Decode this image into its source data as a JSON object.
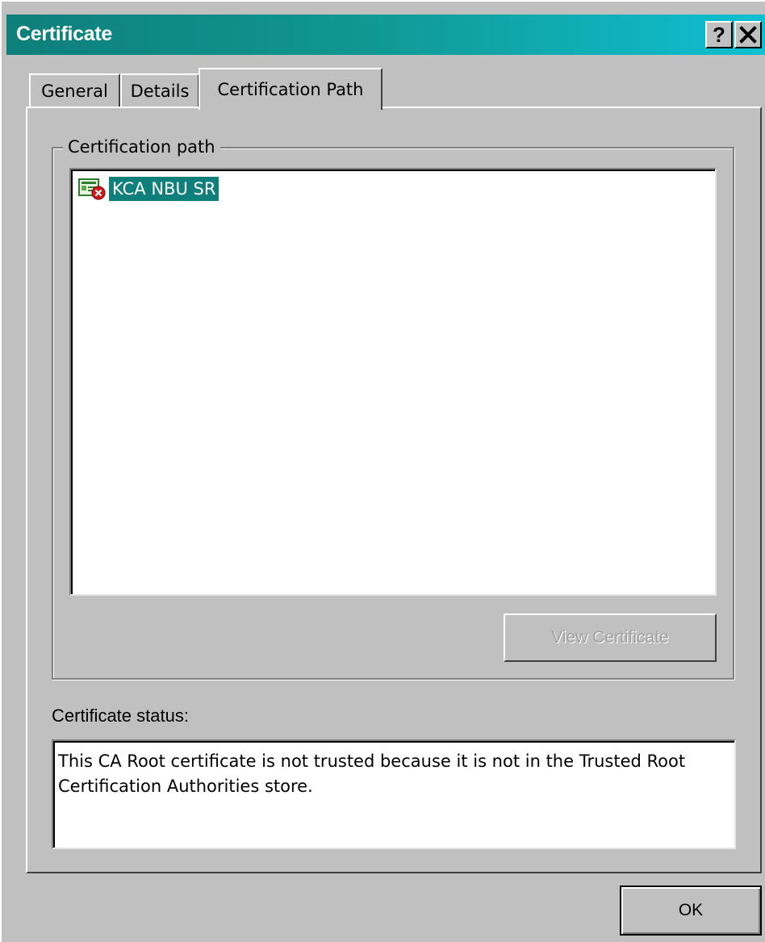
{
  "window": {
    "title": "Certificate",
    "help_button": "?",
    "close_button": "✕"
  },
  "tabs": [
    {
      "label": "General",
      "active": false
    },
    {
      "label": "Details",
      "active": false
    },
    {
      "label": "Certification Path",
      "active": true
    }
  ],
  "certification_path": {
    "group_label": "Certification path",
    "items": [
      {
        "label": "KCA NBU SR",
        "icon": "certificate-error-icon",
        "selected": true
      }
    ],
    "view_button_label": "View Certificate",
    "view_button_enabled": false
  },
  "status": {
    "label": "Certificate status:",
    "text": "This CA Root certificate is not trusted because it is not in the Trusted Root Certification Authorities store."
  },
  "footer": {
    "ok_label": "OK"
  },
  "colors": {
    "titlebar_start": "#0e7f7b",
    "titlebar_end": "#0fc0d2",
    "selection": "#0e7f7b",
    "face": "#c0c0c0"
  }
}
